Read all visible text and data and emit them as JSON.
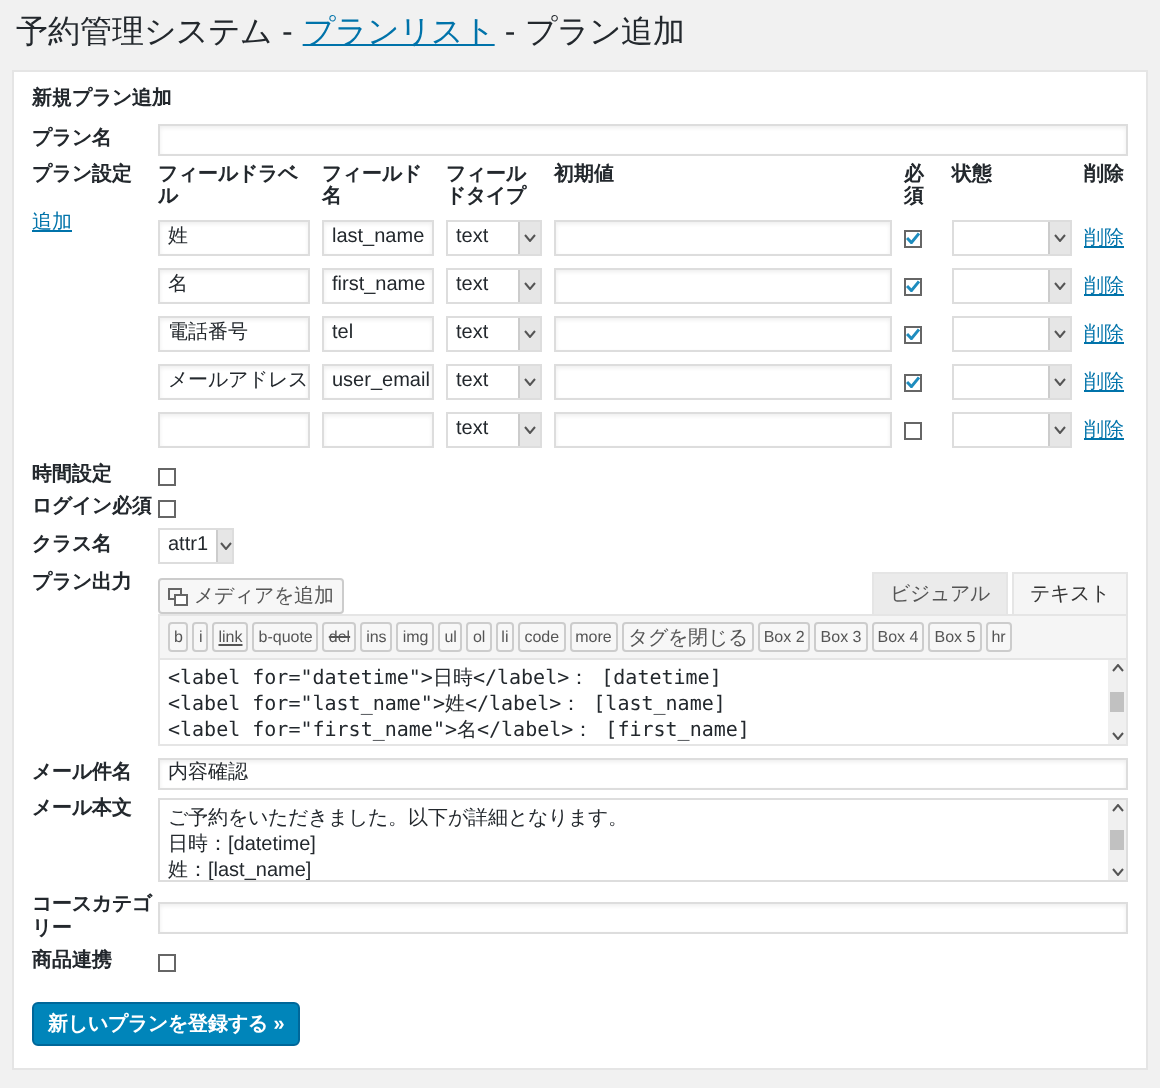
{
  "header": {
    "title": "予約管理システム",
    "separator_1": "-",
    "link": "プランリスト",
    "separator_2": "-",
    "current": "プラン追加"
  },
  "card": {
    "heading": "新規プラン追加"
  },
  "plan_name": {
    "label": "プラン名"
  },
  "plan_settings": {
    "label": "プラン設定",
    "add_link": "追加",
    "columns": [
      "フィールドラベル",
      "フィールド名",
      "フィールドタイプ",
      "初期値",
      "必須",
      "状態",
      "削除"
    ],
    "rows": [
      {
        "label": "姓",
        "name": "last_name",
        "type": "text",
        "required": true,
        "delete": "削除"
      },
      {
        "label": "名",
        "name": "first_name",
        "type": "text",
        "required": true,
        "delete": "削除"
      },
      {
        "label": "電話番号",
        "name": "tel",
        "type": "text",
        "required": true,
        "delete": "削除"
      },
      {
        "label": "メールアドレス",
        "name": "user_email",
        "type": "text",
        "required": true,
        "delete": "削除"
      },
      {
        "label": "",
        "name": "",
        "type": "text",
        "required": false,
        "delete": "削除"
      }
    ]
  },
  "settings": [
    {
      "kind": "checkbox",
      "label": "時間設定",
      "checked": false
    },
    {
      "kind": "checkbox",
      "label": "ログイン必須",
      "checked": false
    },
    {
      "kind": "select",
      "label": "クラス名",
      "value": "attr1"
    }
  ],
  "plan_output": {
    "label": "プラン出力",
    "media_button": "メディアを追加",
    "tabs": [
      {
        "label": "ビジュアル",
        "selected": false
      },
      {
        "label": "テキスト",
        "selected": true
      }
    ],
    "toolbar": [
      {
        "label": "b",
        "kind": "plain"
      },
      {
        "label": "i",
        "kind": "plain"
      },
      {
        "label": "link",
        "kind": "underline"
      },
      {
        "label": "b-quote",
        "kind": "plain"
      },
      {
        "label": "del",
        "kind": "strike"
      },
      {
        "label": "ins",
        "kind": "plain"
      },
      {
        "label": "img",
        "kind": "plain"
      },
      {
        "label": "ul",
        "kind": "plain"
      },
      {
        "label": "ol",
        "kind": "plain"
      },
      {
        "label": "li",
        "kind": "plain"
      },
      {
        "label": "code",
        "kind": "plain"
      },
      {
        "label": "more",
        "kind": "plain"
      },
      {
        "label": "タグを閉じる",
        "kind": "plain"
      },
      {
        "label": "Box 2",
        "kind": "plain"
      },
      {
        "label": "Box 3",
        "kind": "plain"
      },
      {
        "label": "Box 4",
        "kind": "plain"
      },
      {
        "label": "Box 5",
        "kind": "plain"
      },
      {
        "label": "hr",
        "kind": "plain"
      }
    ],
    "content": [
      "<label for=\"datetime\">日時</label>： [datetime]",
      "<label for=\"last_name\">姓</label>： [last_name]",
      "<label for=\"first_name\">名</label>： [first_name]"
    ]
  },
  "mail_subject": {
    "label": "メール件名",
    "value": "内容確認"
  },
  "mail_body": {
    "label": "メール本文",
    "content": [
      "ご予約をいただきました。以下が詳細となります。",
      "日時：[datetime]",
      "姓：[last_name]"
    ]
  },
  "course_category": {
    "label": "コースカテゴリー"
  },
  "product_link": {
    "label": "商品連携",
    "checked": false
  },
  "submit": "新しいプランを登録する »"
}
